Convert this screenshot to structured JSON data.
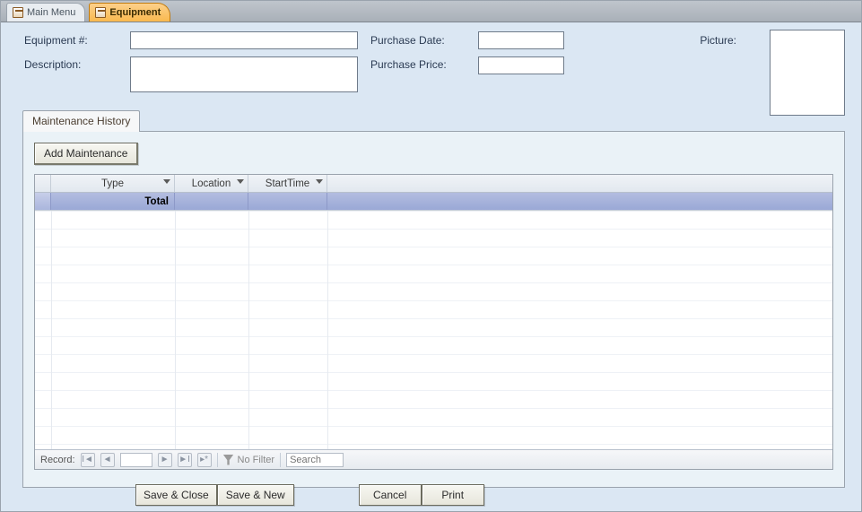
{
  "tabs": {
    "main_menu": "Main Menu",
    "equipment": "Equipment"
  },
  "form": {
    "equipment_number_label": "Equipment #:",
    "equipment_number_value": "",
    "description_label": "Description:",
    "description_value": "",
    "purchase_date_label": "Purchase Date:",
    "purchase_date_value": "",
    "purchase_price_label": "Purchase Price:",
    "purchase_price_value": "",
    "picture_label": "Picture:"
  },
  "inner_tab": {
    "maintenance_history": "Maintenance History"
  },
  "buttons": {
    "add_maintenance": "Add Maintenance",
    "save_close": "Save & Close",
    "save_new": "Save & New",
    "cancel": "Cancel",
    "print": "Print"
  },
  "datasheet": {
    "columns": {
      "type": "Type",
      "location": "Location",
      "start_time": "StartTime"
    },
    "total_label": "Total"
  },
  "recnav": {
    "label": "Record:",
    "no_filter": "No Filter",
    "search_placeholder": "Search"
  }
}
